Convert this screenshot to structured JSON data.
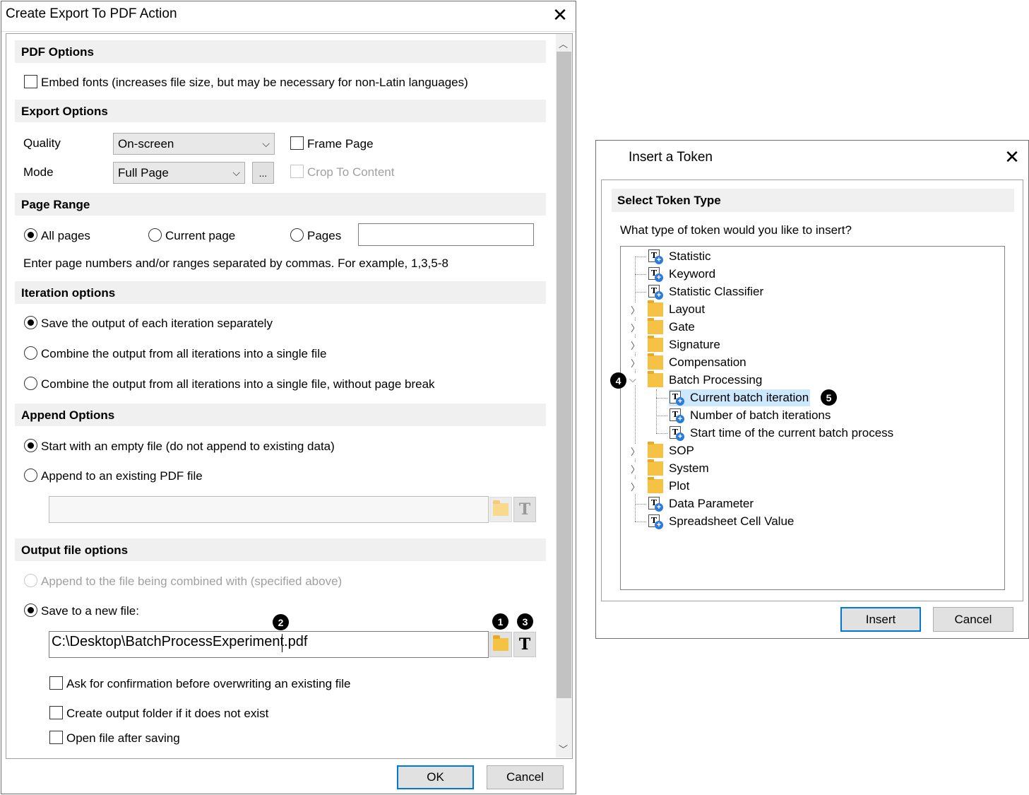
{
  "export_dialog": {
    "title": "Create Export To PDF Action",
    "sections": {
      "pdf_options": "PDF Options",
      "export_options": "Export Options",
      "page_range": "Page Range",
      "iteration_options": "Iteration options",
      "append_options": "Append Options",
      "output_file_options": "Output file options"
    },
    "embed_fonts": "Embed fonts (increases file size, but may be necessary for non-Latin languages)",
    "quality_label": "Quality",
    "quality_value": "On-screen",
    "mode_label": "Mode",
    "mode_value": "Full Page",
    "ellipsis_button": "...",
    "frame_page": "Frame Page",
    "crop_to_content": "Crop To Content",
    "all_pages": "All pages",
    "current_page": "Current page",
    "pages": "Pages",
    "pages_hint": "Enter page numbers and/or ranges separated by commas. For example, 1,3,5-8",
    "iteration_separately": "Save the output of each iteration separately",
    "iteration_combine": "Combine the output from all iterations into a single file",
    "iteration_combine_no_break": "Combine the output from all iterations into a single file, without page break",
    "append_empty": "Start with an empty file (do not append to existing data)",
    "append_existing": "Append to an existing PDF file",
    "append_to_combined": "Append to the file being combined with (specified above)",
    "save_new_file": "Save to a new file:",
    "file_path": "C:\\Desktop\\BatchProcessExperiment.pdf",
    "ask_overwrite": "Ask for confirmation before overwriting an existing file",
    "create_folder": "Create output folder if it does not exist",
    "open_after": "Open file after saving",
    "ok": "OK",
    "cancel": "Cancel",
    "token_glyph": "T"
  },
  "badges": [
    "1",
    "2",
    "3",
    "4",
    "5"
  ],
  "token_dialog": {
    "title": "Insert a Token",
    "section": "Select Token Type",
    "question": "What type of token would you like to insert?",
    "tree": [
      {
        "label": "Statistic",
        "kind": "token"
      },
      {
        "label": "Keyword",
        "kind": "token"
      },
      {
        "label": "Statistic Classifier",
        "kind": "token"
      },
      {
        "label": "Layout",
        "kind": "folder"
      },
      {
        "label": "Gate",
        "kind": "folder"
      },
      {
        "label": "Signature",
        "kind": "folder"
      },
      {
        "label": "Compensation",
        "kind": "folder"
      },
      {
        "label": "Batch Processing",
        "kind": "folder-open"
      },
      {
        "label": "Current batch iteration",
        "kind": "token-child",
        "selected": true
      },
      {
        "label": "Number of batch iterations",
        "kind": "token-child"
      },
      {
        "label": "Start time of the current batch process",
        "kind": "token-child"
      },
      {
        "label": "SOP",
        "kind": "folder"
      },
      {
        "label": "System",
        "kind": "folder"
      },
      {
        "label": "Plot",
        "kind": "folder"
      },
      {
        "label": "Data Parameter",
        "kind": "token"
      },
      {
        "label": "Spreadsheet Cell Value",
        "kind": "token"
      }
    ],
    "insert": "Insert",
    "cancel": "Cancel"
  },
  "colors": {
    "selection": "#cce8ff",
    "default_button_border": "#0078d7",
    "folder": "#f6c243"
  }
}
